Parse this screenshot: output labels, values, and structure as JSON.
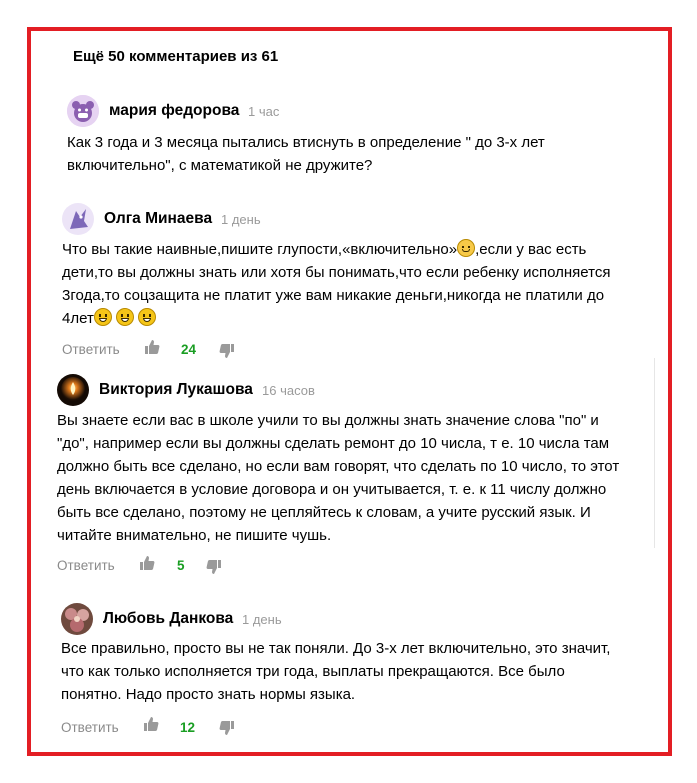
{
  "header": {
    "more_comments": "Ещё 50 комментариев из 61"
  },
  "comments": [
    {
      "author": "мария федорова",
      "time": "1 час",
      "lines": [
        "Как 3 года и 3 месяца пытались втиснуть в определение \" до 3-х лет",
        "включительно\", с математикой не дружите?"
      ]
    },
    {
      "author": "Олга Минаева",
      "time": "1 день",
      "lines": [
        "Что вы такие наивные,пишите глупости,«включительно»",
        ",если у вас есть",
        "дети,то вы должны знать или хотя бы понимать,что если ребенку исполняется",
        "3года,то соцзащита не платит уже вам никакие деньги,никогда не платили до",
        "4лет"
      ],
      "reply": "Ответить",
      "likes": "24"
    },
    {
      "author": "Виктория Лукашова",
      "time": "16 часов",
      "lines": [
        "Вы знаете если вас в школе учили то вы должны знать значение слова \"по\" и",
        "\"до\", например если вы должны сделать ремонт до 10 числа, т е. 10 числа там",
        "должно быть все сделано, но если вам говорят, что сделать по 10 число, то этот",
        "день включается в условие договора и он учитывается, т. е. к 11 числу должно",
        "быть все сделано, поэтому не цепляйтесь к словам, а учите русский язык. И",
        "читайте внимательно, не пишите чушь."
      ],
      "reply": "Ответить",
      "likes": "5"
    },
    {
      "author": "Любовь Данкова",
      "time": "1 день",
      "lines": [
        "Все правильно, просто вы не так поняли. До 3-х лет включительно, это значит,",
        "что как только исполняется три года, выплаты прекращаются. Все было",
        "понятно. Надо просто знать нормы языка."
      ],
      "reply": "Ответить",
      "likes": "12"
    }
  ],
  "icons": {
    "like": "thumbs-up-icon",
    "dislike": "thumbs-down-icon",
    "emoji_smile": "smiling-face-emoji",
    "emoji_grin": "grinning-face-emoji"
  },
  "colors": {
    "frame": "#e31e24",
    "likes": "#1a9e23",
    "muted": "#9a9a9a"
  }
}
